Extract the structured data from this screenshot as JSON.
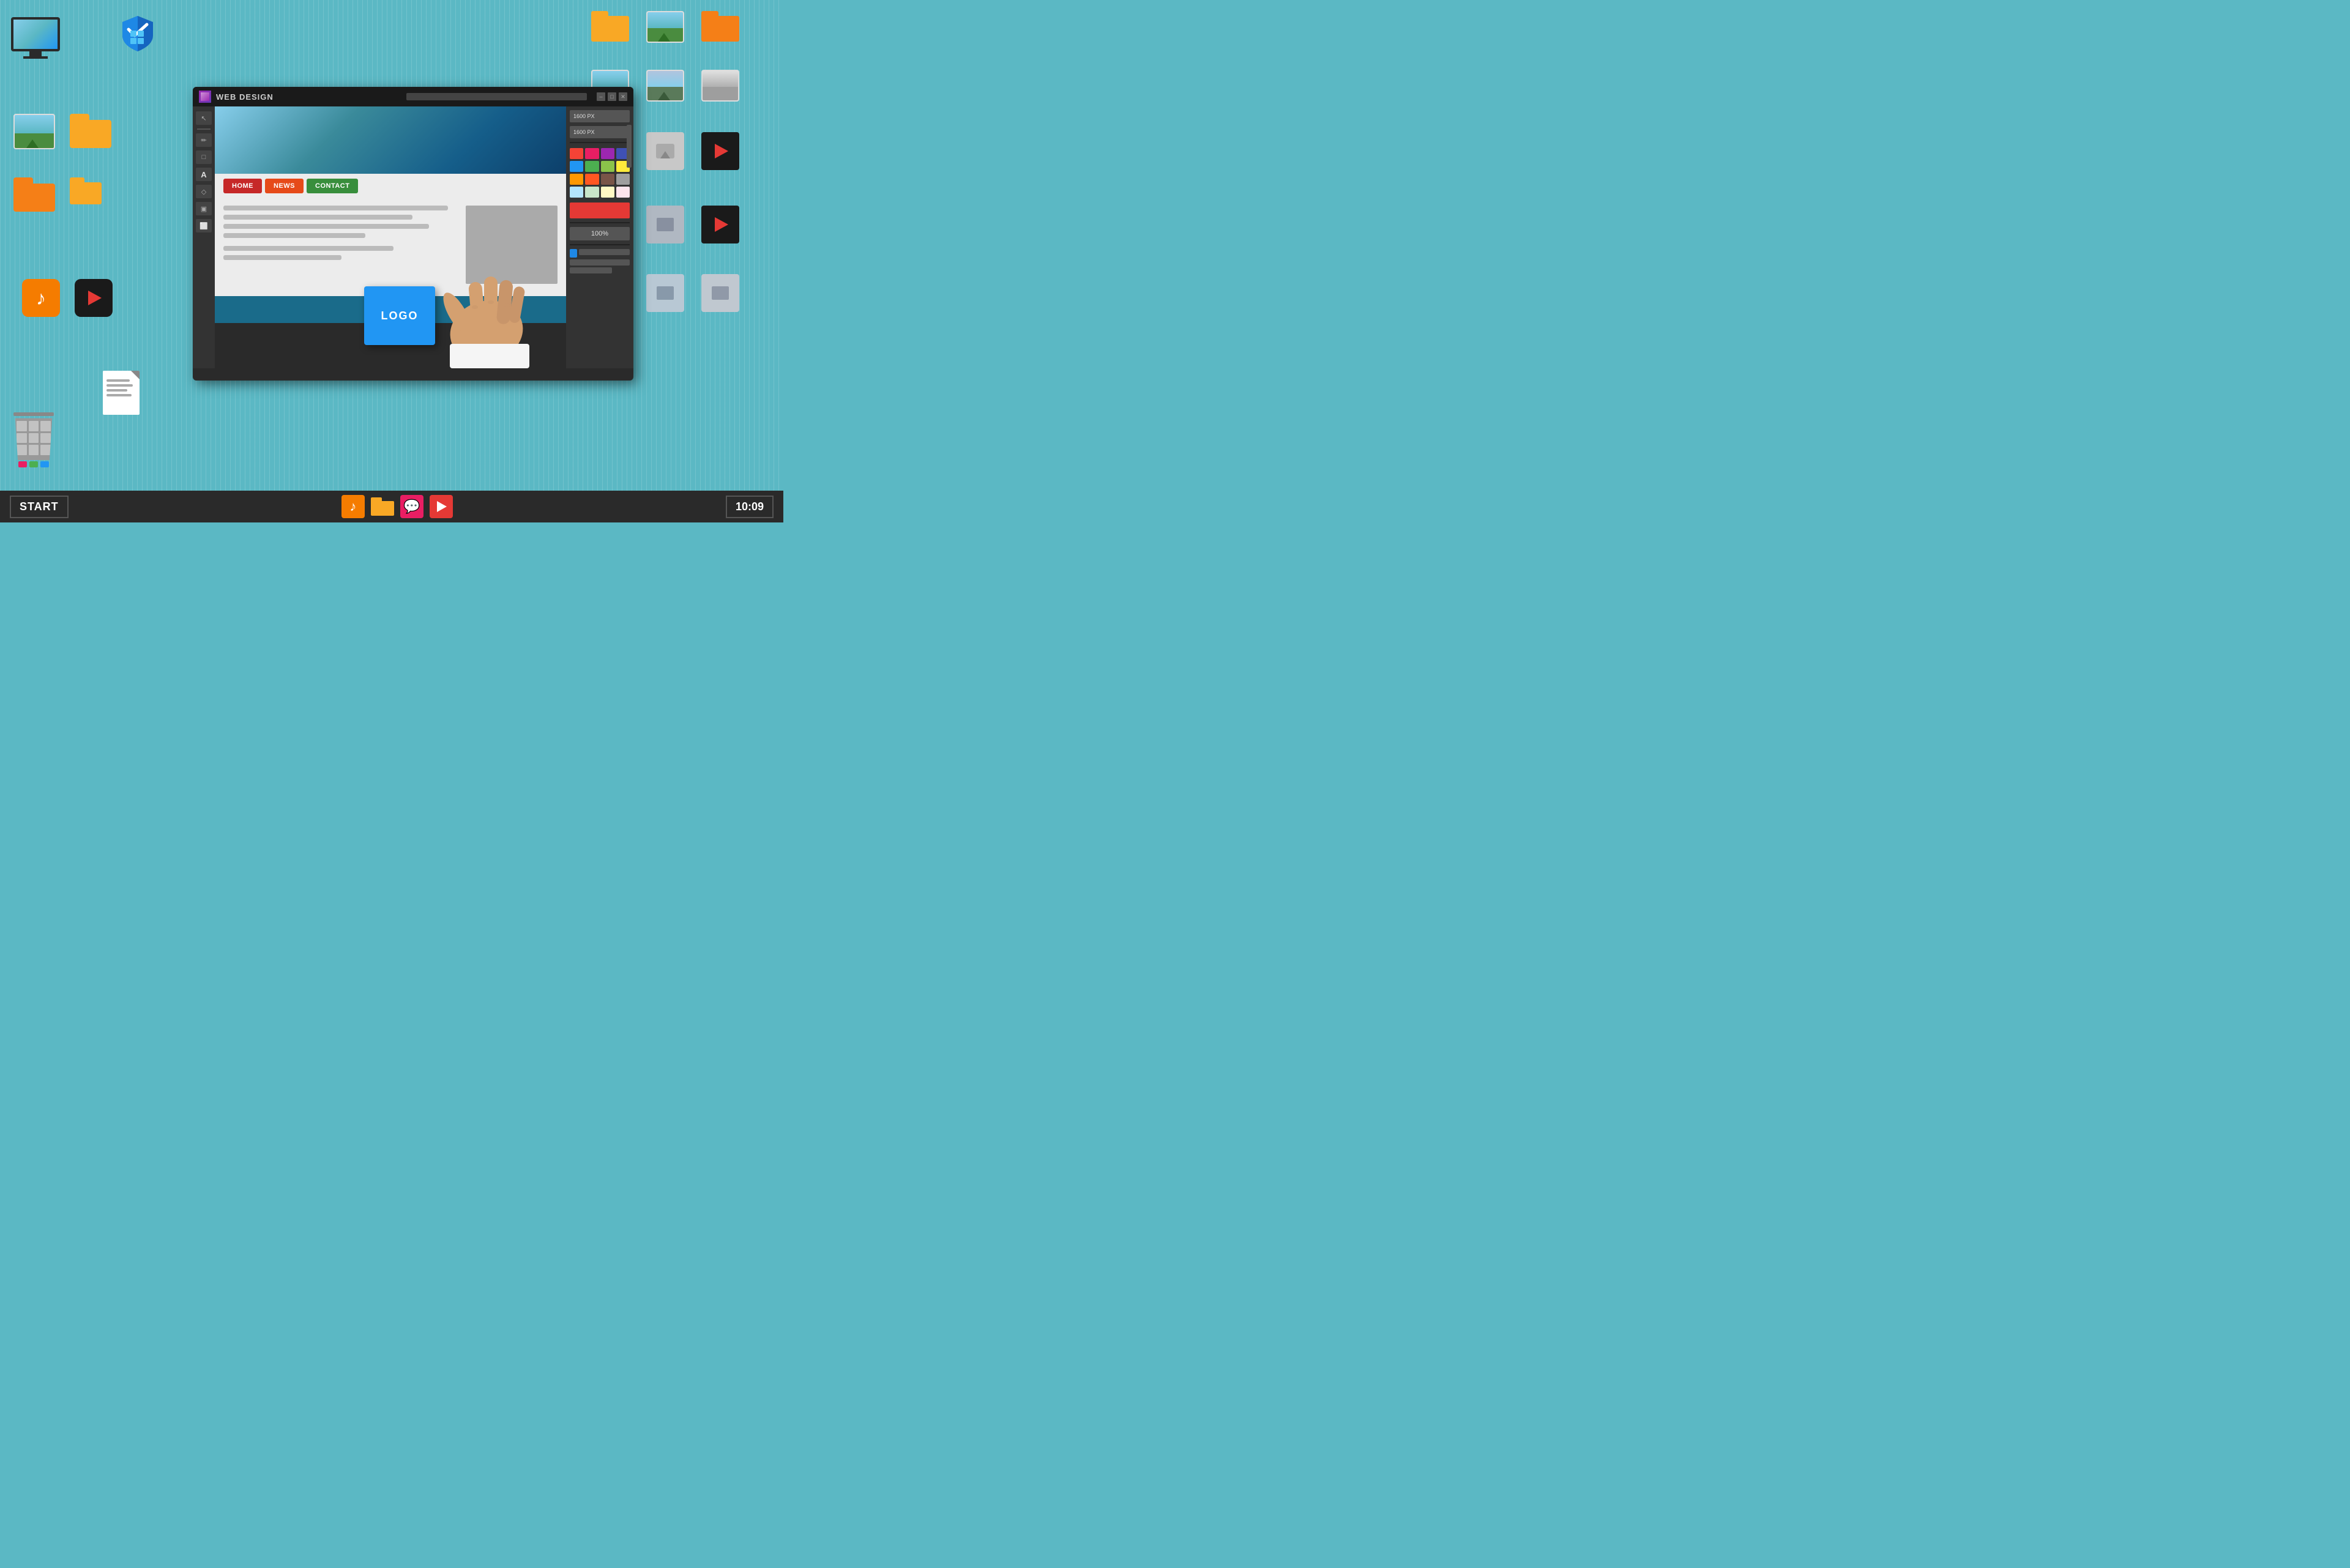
{
  "background": {
    "color": "#5bb8c4"
  },
  "taskbar": {
    "start_label": "START",
    "clock": "10:09",
    "icons": [
      {
        "name": "music",
        "color": "#f57c00",
        "symbol": "♪"
      },
      {
        "name": "folder",
        "color": "#f9a825",
        "symbol": "📁"
      },
      {
        "name": "chat",
        "color": "#e91e63",
        "symbol": "💬"
      },
      {
        "name": "play",
        "color": "#e53935",
        "symbol": "▶"
      }
    ]
  },
  "web_window": {
    "title": "WEB DESIGN",
    "size_input_1": "1600 PX",
    "size_input_2": "1600 PX",
    "zoom_label": "100%",
    "nav_items": [
      {
        "label": "HOME",
        "color": "#c62828"
      },
      {
        "label": "NEWS",
        "color": "#e64a19"
      },
      {
        "label": "CONTACT",
        "color": "#388e3c"
      }
    ],
    "logo_label": "LOGO",
    "controls": [
      "-",
      "□",
      "✕"
    ]
  },
  "color_swatches": [
    "#f44336",
    "#e91e63",
    "#9c27b0",
    "#673ab7",
    "#3f51b5",
    "#2196f3",
    "#03a9f4",
    "#00bcd4",
    "#009688",
    "#4caf50",
    "#8bc34a",
    "#cddc39",
    "#ffeb3b",
    "#ffc107",
    "#ff9800",
    "#ff5722",
    "#795548",
    "#9e9e9e",
    "#607d8b",
    "#000000"
  ],
  "desktop_icons": {
    "monitor_label": "monitor",
    "shield_label": "windows-shield",
    "folder_yellow_label": "folder",
    "folder_colors": [
      "#f9a825",
      "#f57f17"
    ],
    "music_icon_color": "#f57c00",
    "play_icon_color": "#e53935",
    "trash_label": "recycle bin"
  }
}
